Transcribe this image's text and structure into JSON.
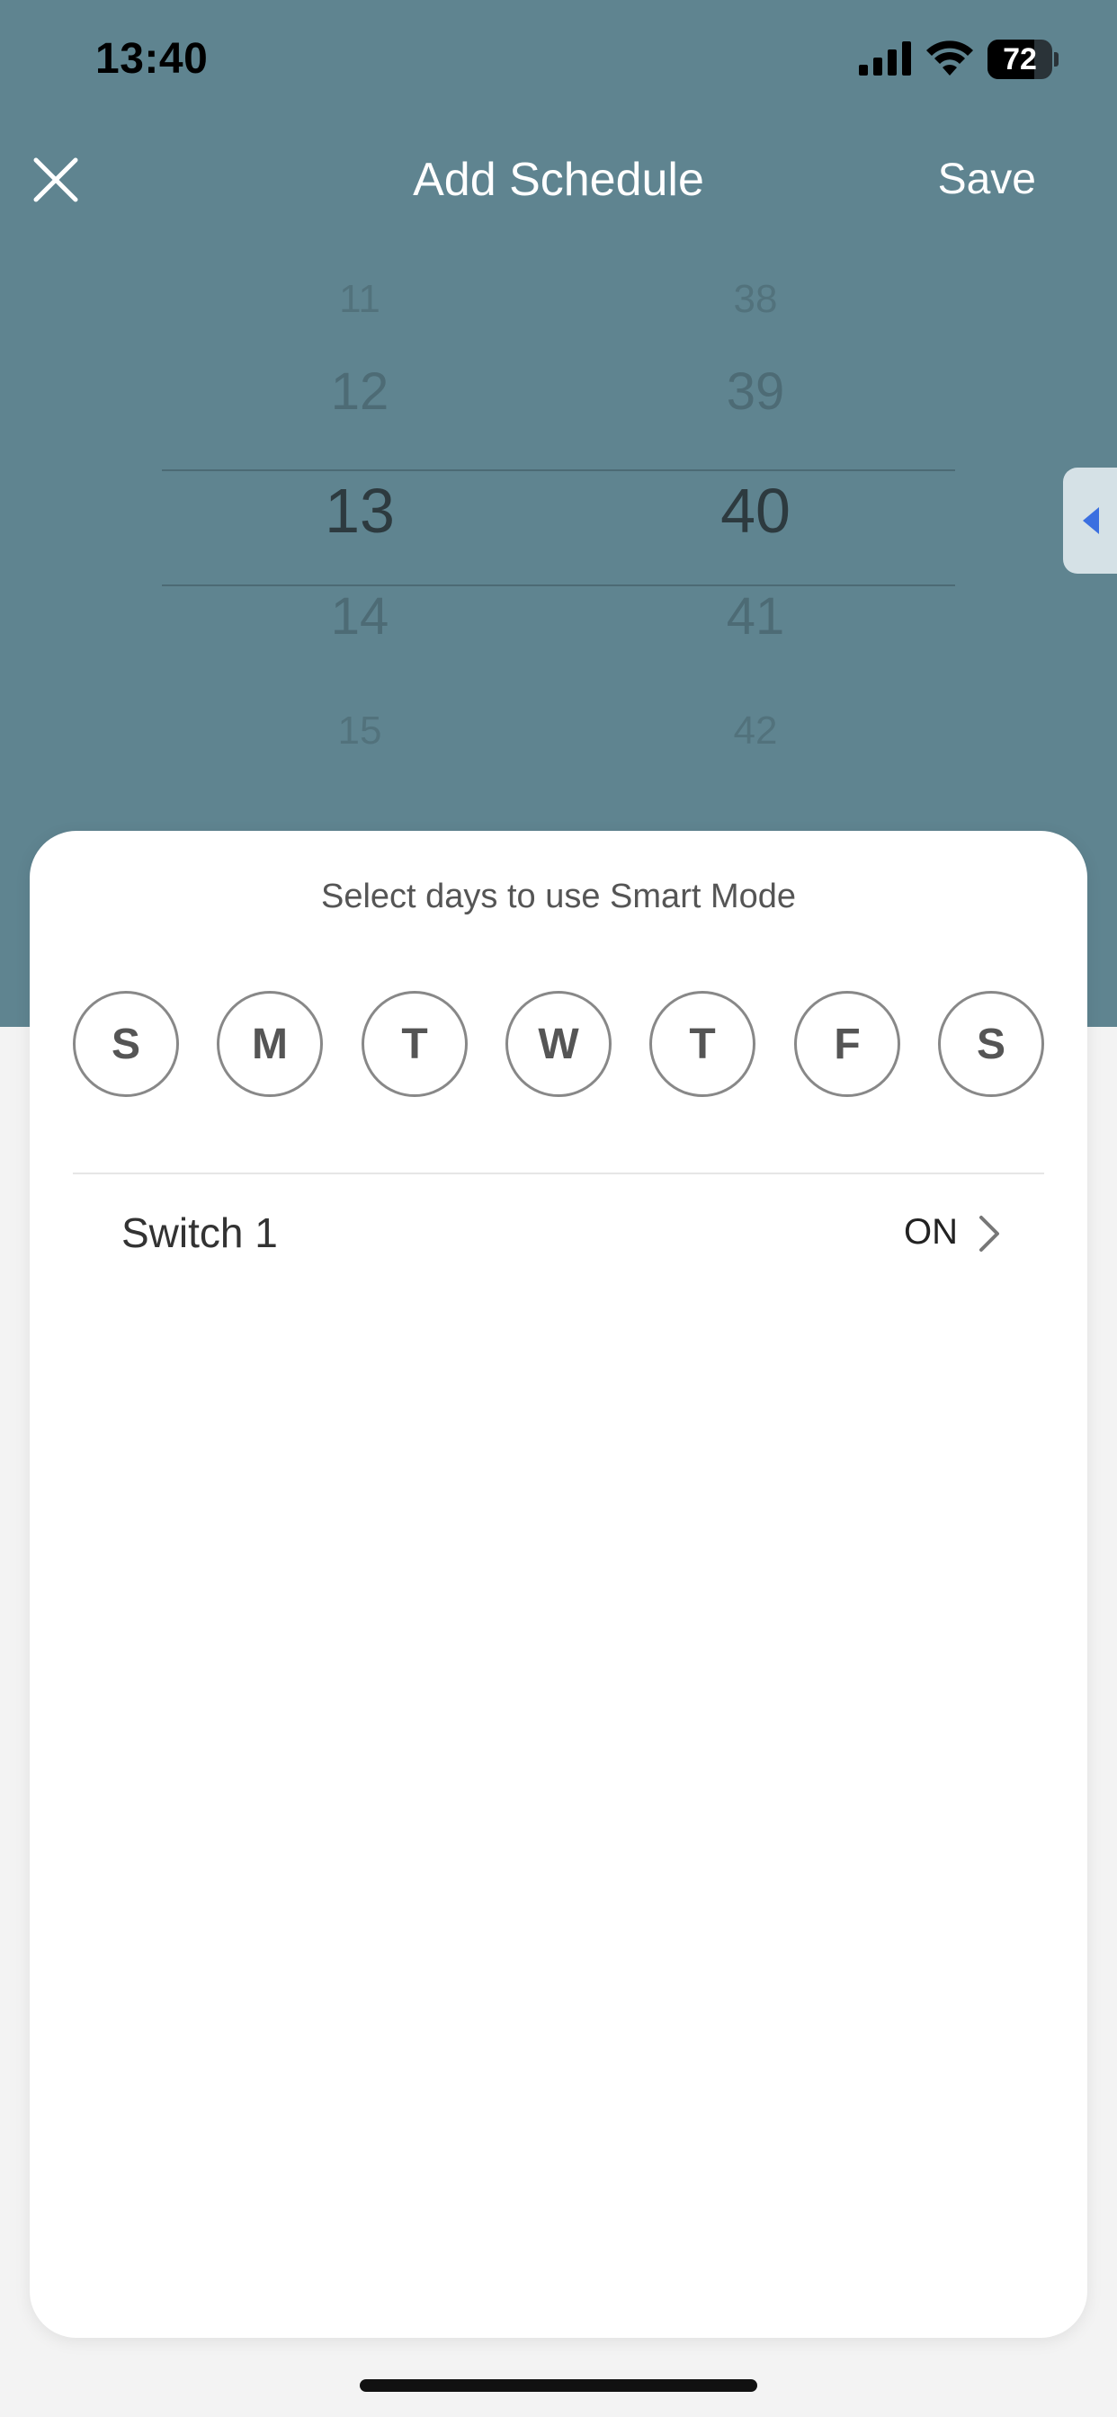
{
  "status_bar": {
    "time": "13:40",
    "battery_level": "72",
    "signal_icon": "cellular-signal-icon",
    "wifi_icon": "wifi-icon"
  },
  "nav": {
    "close_icon": "close-icon",
    "title": "Add Schedule",
    "save_label": "Save"
  },
  "picker": {
    "hours": [
      "11",
      "12",
      "13",
      "14",
      "15"
    ],
    "minutes": [
      "38",
      "39",
      "40",
      "41",
      "42"
    ],
    "selected_hour": "13",
    "selected_minute": "40"
  },
  "card": {
    "prompt": "Select days to use Smart Mode",
    "days": [
      "S",
      "M",
      "T",
      "W",
      "T",
      "F",
      "S"
    ],
    "switch": {
      "label": "Switch 1",
      "value": "ON"
    }
  },
  "colors": {
    "header_bg": "#5f8490",
    "card_bg": "#ffffff",
    "side_tab_arrow": "#3b6fe0"
  }
}
